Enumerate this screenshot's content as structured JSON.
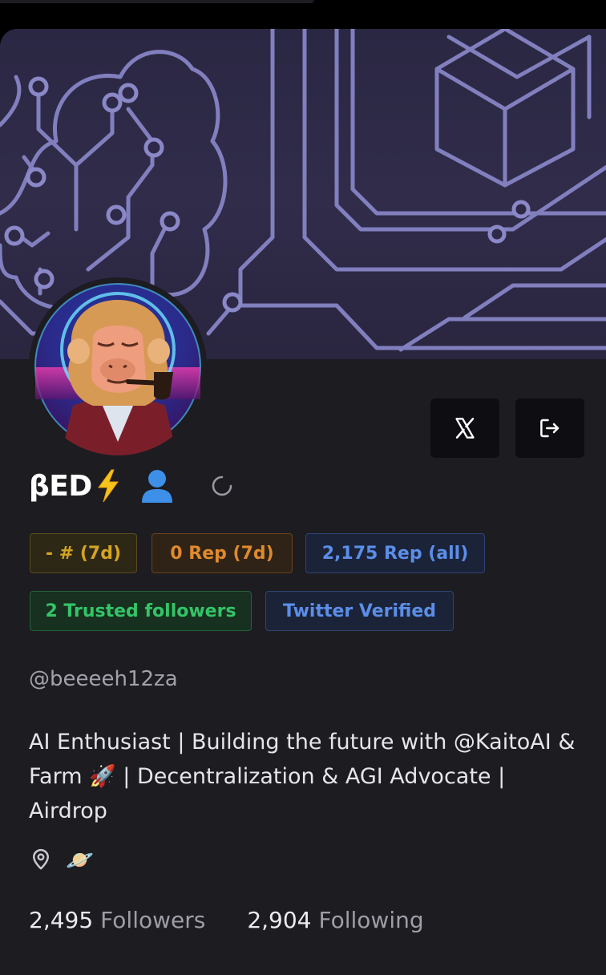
{
  "profile": {
    "display_name": "βED",
    "name_emoji": "⚡",
    "handle": "@beeeeh12za",
    "bio": "AI Enthusiast | Building the future with @KaitoAI & Farm 🚀 | Decentralization & AGI Advocate | Airdrop",
    "location_emoji": "🪐"
  },
  "badges": {
    "rank_7d": "- # (7d)",
    "rep_7d": "0 Rep (7d)",
    "rep_all": "2,175 Rep (all)",
    "trusted_followers": "2 Trusted followers",
    "twitter_verified": "Twitter Verified"
  },
  "stats": {
    "followers_count": "2,495",
    "followers_label": "Followers",
    "following_count": "2,904",
    "following_label": "Following"
  },
  "icons": {
    "x_button": "x-logo-icon",
    "logout_button": "logout-icon",
    "person": "person-icon",
    "spinner": "loading-spinner-icon",
    "location": "location-pin-icon"
  },
  "colors": {
    "card_bg": "#1c1c21",
    "banner_bg": "#2d2946",
    "banner_lines": "#8b88c8",
    "rank_badge": "#d4a422",
    "rep7_badge": "#df8a2e",
    "rep_all_badge": "#5b8ee8",
    "trusted_badge": "#34c468",
    "person_icon": "#3d8fe8"
  }
}
